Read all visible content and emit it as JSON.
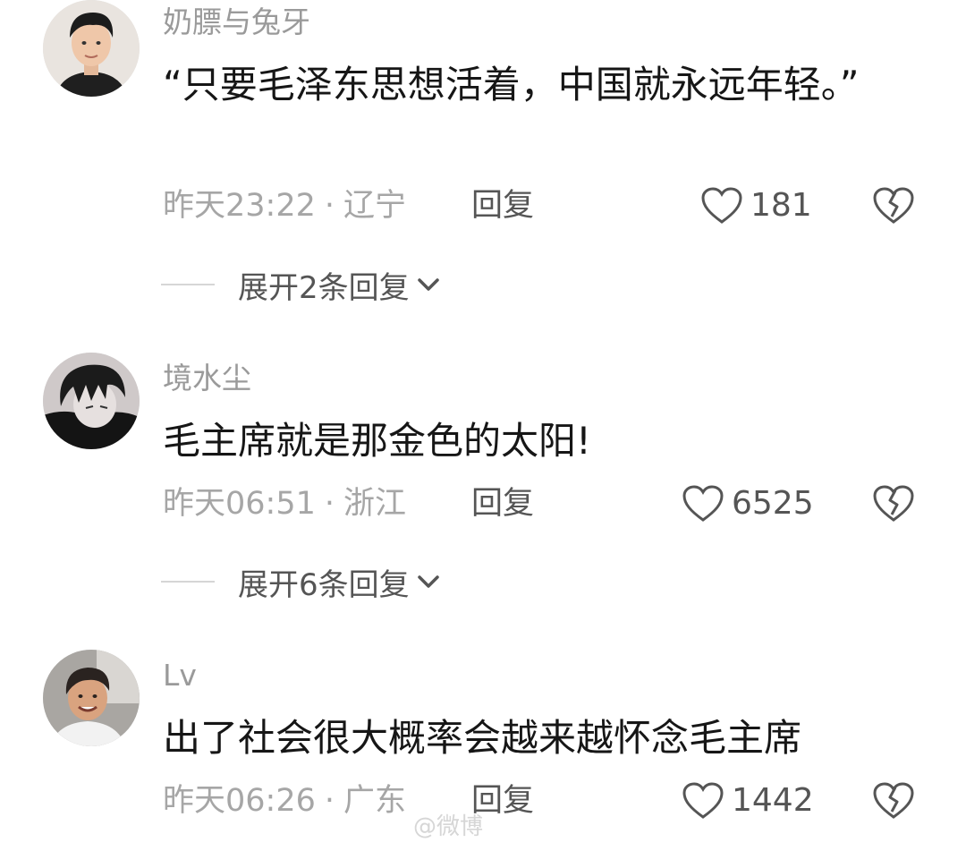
{
  "comments": [
    {
      "username": "奶膘与兔牙",
      "content": "“只要毛泽东思想活着，中国就永远年轻。”",
      "time": "昨天23:22",
      "location": "辽宁",
      "separator": "·",
      "reply_label": "回复",
      "likes": "181",
      "expand_label": "展开2条回复",
      "avatar_icon": "avatar-young-man-icon"
    },
    {
      "username": "境水尘",
      "content": "毛主席就是那金色的太阳!",
      "time": "昨天06:51",
      "location": "浙江",
      "separator": "·",
      "reply_label": "回复",
      "likes": "6525",
      "expand_label": "展开6条回复",
      "avatar_icon": "avatar-anime-character-icon"
    },
    {
      "username": "Lv",
      "content": "出了社会很大概率会越来越怀念毛主席",
      "time": "昨天06:26",
      "location": "广东",
      "separator": "·",
      "reply_label": "回复",
      "likes": "1442",
      "avatar_icon": "avatar-smiling-man-icon"
    }
  ],
  "watermark": "@微博",
  "colors": {
    "username": "#9a9a9a",
    "text": "#161616",
    "meta": "#a6a6a6",
    "action": "#555555"
  },
  "icons": {
    "like": "heart-outline-icon",
    "dislike": "broken-heart-icon",
    "expand": "chevron-down-icon"
  }
}
